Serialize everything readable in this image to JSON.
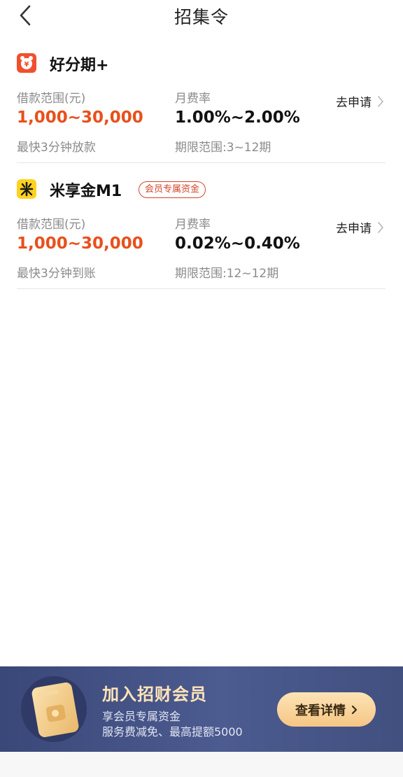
{
  "header": {
    "title": "招集令",
    "back_icon": "chevron-left-icon"
  },
  "products": [
    {
      "name": "好分期+",
      "icon": "alarm-clock-yen-icon",
      "icon_color": "#f0502f",
      "badge": "",
      "amount_label": "借款范围(元)",
      "amount_range": "1,000~30,000",
      "rate_label": "月费率",
      "rate_range": "1.00%~2.00%",
      "speed_text": "最快3分钟放款",
      "term_text": "期限范围:3~12期",
      "apply_label": "去申请"
    },
    {
      "name": "米享金M1",
      "icon": "mi-logo-icon",
      "icon_color": "#ffd21f",
      "badge": "会员专属资金",
      "amount_label": "借款范围(元)",
      "amount_range": "1,000~30,000",
      "rate_label": "月费率",
      "rate_range": "0.02%~0.40%",
      "speed_text": "最快3分钟到账",
      "term_text": "期限范围:12~12期",
      "apply_label": "去申请"
    }
  ],
  "banner": {
    "title": "加入招财会员",
    "line1": "享会员专属资金",
    "line2": "服务费减免、最高提额5000",
    "button_label": "查看详情",
    "card_icon": "membership-card-icon"
  },
  "colors": {
    "accent_orange": "#e8501c",
    "badge_red": "#d2462a",
    "banner_bg": "#46558a",
    "banner_title": "#ffe4b8",
    "button_gold": "#f5c684"
  }
}
